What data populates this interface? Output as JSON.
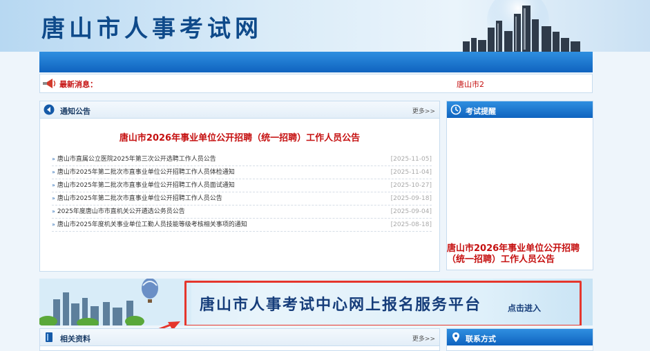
{
  "header": {
    "site_title": "唐山市人事考试网"
  },
  "newsbar": {
    "label": "最新消息：",
    "ticker": "唐山市2"
  },
  "notice": {
    "title": "通知公告",
    "more": "更多>>",
    "featured": "唐山市2026年事业单位公开招聘（统一招聘）工作人员公告",
    "items": [
      {
        "text": "唐山市直属公立医院2025年第三次公开选聘工作人员公告",
        "date": "[2025-11-05]"
      },
      {
        "text": "唐山市2025年第二批次市直事业单位公开招聘工作人员体检通知",
        "date": "[2025-11-04]"
      },
      {
        "text": "唐山市2025年第二批次市直事业单位公开招聘工作人员面试通知",
        "date": "[2025-10-27]"
      },
      {
        "text": "唐山市2025年第二批次市直事业单位公开招聘工作人员公告",
        "date": "[2025-09-18]"
      },
      {
        "text": "2025年度唐山市市直机关公开遴选公务员公告",
        "date": "[2025-09-04]"
      },
      {
        "text": "唐山市2025年度机关事业单位工勤人员技能等级考核相关事项的通知",
        "date": "[2025-08-18]"
      }
    ]
  },
  "exam": {
    "title": "考试提醒",
    "scroll_text": "唐山市2026年事业单位公开招聘（统一招聘）工作人员公告"
  },
  "banner": {
    "title": "唐山市人事考试中心网上报名服务平台",
    "sub": "点击进入"
  },
  "related": {
    "title": "相关资料",
    "more": "更多>>"
  },
  "contact": {
    "title": "联系方式"
  },
  "colors": {
    "accent_blue": "#0f63bf",
    "alert_red": "#c51010",
    "banner_border": "#e5362c"
  }
}
